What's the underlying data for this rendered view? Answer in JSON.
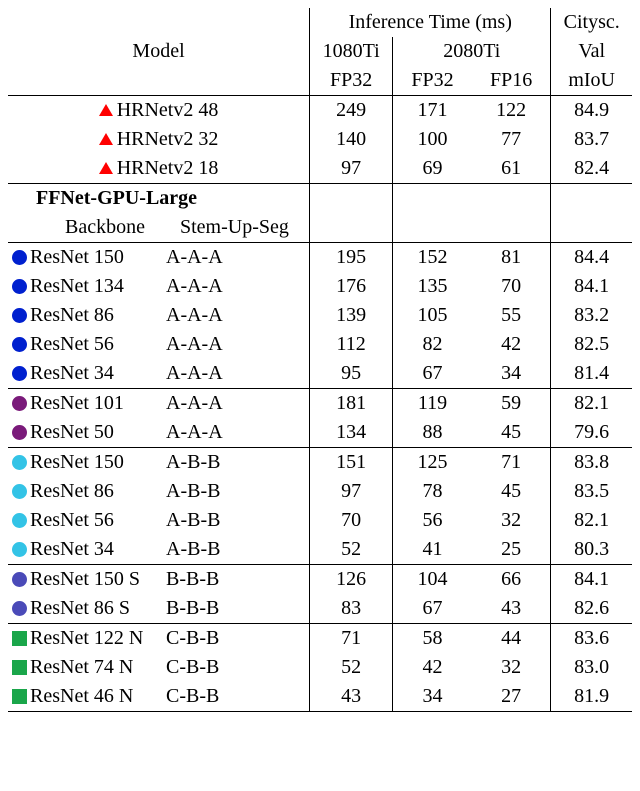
{
  "chart_data": {
    "type": "table",
    "title": "",
    "columns": [
      "Model",
      "1080Ti FP32",
      "2080Ti FP32",
      "2080Ti FP16",
      "Citysc. Val mIoU"
    ],
    "column_groups": {
      "inference_time_ms": [
        "1080Ti FP32",
        "2080Ti FP32",
        "2080Ti FP16"
      ],
      "citysc_val": [
        "mIoU"
      ]
    },
    "groups": [
      {
        "name": "HRNetv2",
        "marker": {
          "shape": "triangle",
          "color": "#ff0000"
        },
        "rows": [
          {
            "backbone": "HRNetv2 48",
            "sus": null,
            "t1080fp32": 249,
            "t2080fp32": 171,
            "t2080fp16": 122,
            "miou": 84.9
          },
          {
            "backbone": "HRNetv2 32",
            "sus": null,
            "t1080fp32": 140,
            "t2080fp32": 100,
            "t2080fp16": 77,
            "miou": 83.7
          },
          {
            "backbone": "HRNetv2 18",
            "sus": null,
            "t1080fp32": 97,
            "t2080fp32": 69,
            "t2080fp16": 61,
            "miou": 82.4
          }
        ]
      },
      {
        "section": "FFNet-GPU-Large",
        "subheaders": {
          "backbone": "Backbone",
          "sus": "Stem-Up-Seg"
        },
        "subgroups": [
          {
            "marker": {
              "shape": "circle",
              "color": "#0020cf"
            },
            "rows": [
              {
                "backbone": "ResNet 150",
                "sus": "A-A-A",
                "t1080fp32": 195,
                "t2080fp32": 152,
                "t2080fp16": 81,
                "miou": 84.4
              },
              {
                "backbone": "ResNet 134",
                "sus": "A-A-A",
                "t1080fp32": 176,
                "t2080fp32": 135,
                "t2080fp16": 70,
                "miou": 84.1
              },
              {
                "backbone": "ResNet 86",
                "sus": "A-A-A",
                "t1080fp32": 139,
                "t2080fp32": 105,
                "t2080fp16": 55,
                "miou": 83.2
              },
              {
                "backbone": "ResNet 56",
                "sus": "A-A-A",
                "t1080fp32": 112,
                "t2080fp32": 82,
                "t2080fp16": 42,
                "miou": 82.5
              },
              {
                "backbone": "ResNet 34",
                "sus": "A-A-A",
                "t1080fp32": 95,
                "t2080fp32": 67,
                "t2080fp16": 34,
                "miou": 81.4
              }
            ]
          },
          {
            "marker": {
              "shape": "circle",
              "color": "#7a1a7a"
            },
            "rows": [
              {
                "backbone": "ResNet 101",
                "sus": "A-A-A",
                "t1080fp32": 181,
                "t2080fp32": 119,
                "t2080fp16": 59,
                "miou": 82.1
              },
              {
                "backbone": "ResNet 50",
                "sus": "A-A-A",
                "t1080fp32": 134,
                "t2080fp32": 88,
                "t2080fp16": 45,
                "miou": 79.6
              }
            ]
          },
          {
            "marker": {
              "shape": "circle",
              "color": "#33c3e6"
            },
            "rows": [
              {
                "backbone": "ResNet 150",
                "sus": "A-B-B",
                "t1080fp32": 151,
                "t2080fp32": 125,
                "t2080fp16": 71,
                "miou": 83.8
              },
              {
                "backbone": "ResNet 86",
                "sus": "A-B-B",
                "t1080fp32": 97,
                "t2080fp32": 78,
                "t2080fp16": 45,
                "miou": 83.5
              },
              {
                "backbone": "ResNet 56",
                "sus": "A-B-B",
                "t1080fp32": 70,
                "t2080fp32": 56,
                "t2080fp16": 32,
                "miou": 82.1
              },
              {
                "backbone": "ResNet 34",
                "sus": "A-B-B",
                "t1080fp32": 52,
                "t2080fp32": 41,
                "t2080fp16": 25,
                "miou": 80.3
              }
            ]
          },
          {
            "marker": {
              "shape": "circle",
              "color": "#4a4ab8"
            },
            "rows": [
              {
                "backbone": "ResNet 150 S",
                "sus": "B-B-B",
                "t1080fp32": 126,
                "t2080fp32": 104,
                "t2080fp16": 66,
                "miou": 84.1
              },
              {
                "backbone": "ResNet 86 S",
                "sus": "B-B-B",
                "t1080fp32": 83,
                "t2080fp32": 67,
                "t2080fp16": 43,
                "miou": 82.6
              }
            ]
          },
          {
            "marker": {
              "shape": "square",
              "color": "#1aa64a"
            },
            "rows": [
              {
                "backbone": "ResNet 122 N",
                "sus": "C-B-B",
                "t1080fp32": 71,
                "t2080fp32": 58,
                "t2080fp16": 44,
                "miou": 83.6
              },
              {
                "backbone": "ResNet 74 N",
                "sus": "C-B-B",
                "t1080fp32": 52,
                "t2080fp32": 42,
                "t2080fp16": 32,
                "miou": 83.0
              },
              {
                "backbone": "ResNet 46 N",
                "sus": "C-B-B",
                "t1080fp32": 43,
                "t2080fp32": 34,
                "t2080fp16": 27,
                "miou": 81.9
              }
            ]
          }
        ]
      }
    ]
  },
  "header": {
    "model": "Model",
    "inf_time": "Inference Time (ms)",
    "citysc": "Citysc.",
    "gpu_1080": "1080Ti",
    "gpu_2080": "2080Ti",
    "val": "Val",
    "fp32a": "FP32",
    "fp32b": "FP32",
    "fp16": "FP16",
    "miou": "mIoU"
  }
}
